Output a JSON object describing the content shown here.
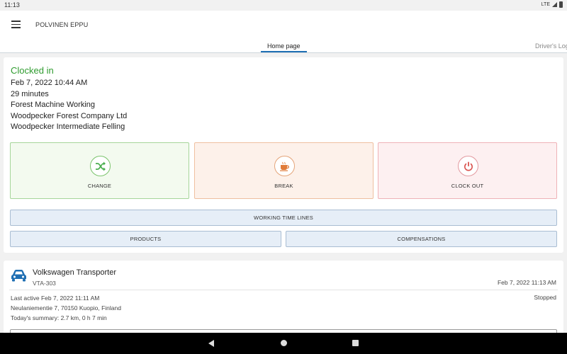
{
  "status_bar": {
    "time": "11:13",
    "network": "LTE",
    "icons": [
      "signal-icon",
      "battery-icon"
    ]
  },
  "app_bar": {
    "title": "POLVINEN EPPU",
    "menu_icon": "hamburger-menu-icon"
  },
  "tabs": [
    {
      "label": "Home page",
      "active": true
    },
    {
      "label": "Driver's Log",
      "active": false
    }
  ],
  "work_status": {
    "title": "Clocked in",
    "title_color": "#2e9b2e",
    "date_time": "Feb 7, 2022 10:44 AM",
    "duration": "29 minutes",
    "work_type": "Forest Machine Working",
    "company": "Woodpecker Forest Company Ltd",
    "task": "Woodpecker Intermediate Felling"
  },
  "actions": [
    {
      "label": "CHANGE",
      "icon": "shuffle-icon",
      "color": "#4caf50"
    },
    {
      "label": "BREAK",
      "icon": "coffee-cup-icon",
      "color": "#e07b39"
    },
    {
      "label": "CLOCK OUT",
      "icon": "power-icon",
      "color": "#d9534f"
    }
  ],
  "buttons": {
    "working_time_lines": "WORKING TIME LINES",
    "products": "PRODUCTS",
    "compensations": "COMPENSATIONS"
  },
  "vehicle": {
    "icon": "car-icon",
    "icon_color": "#1f6fb3",
    "name": "Volkswagen Transporter",
    "registration": "VTA-303",
    "timestamp": "Feb 7, 2022 11:13 AM",
    "last_active": "Last active Feb 7, 2022 11:11 AM",
    "address": "Neulaniementie 7, 70150 Kuopio, Finland",
    "summary": "Today's summary: 2.7 km, 0 h 7 min",
    "status": "Stopped"
  },
  "nav_bar": {
    "icons": [
      "back-icon",
      "home-icon",
      "recent-apps-icon"
    ]
  }
}
